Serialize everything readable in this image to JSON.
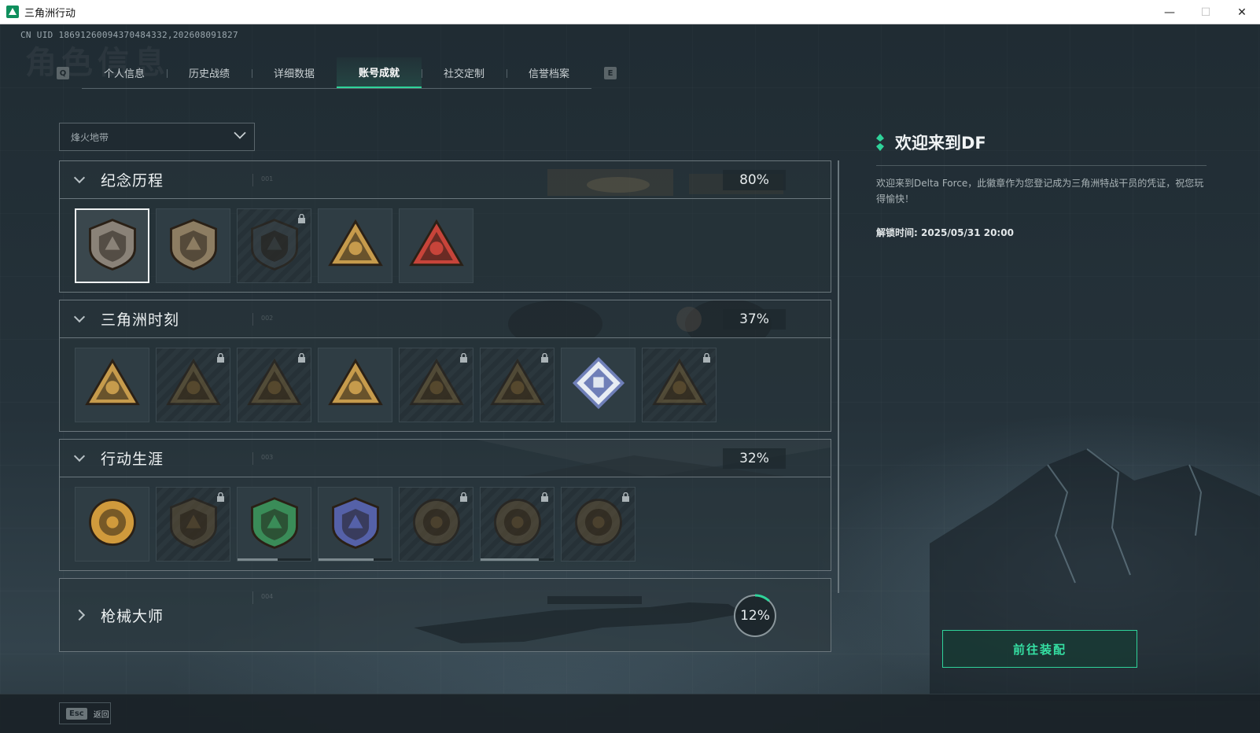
{
  "window": {
    "title": "三角洲行动",
    "minimize": "—",
    "maximize": "☐",
    "close": "✕"
  },
  "uid": "CN UID 18691260094370484332,202608091827",
  "ghost_heading": "角色信息",
  "tabs": {
    "left_key": "Q",
    "right_key": "E",
    "items": [
      {
        "label": "个人信息"
      },
      {
        "label": "历史战绩"
      },
      {
        "label": "详细数据"
      },
      {
        "label": "账号成就"
      },
      {
        "label": "社交定制"
      },
      {
        "label": "信誉档案"
      }
    ],
    "active_index": 3
  },
  "filter": {
    "selected": "烽火地带"
  },
  "sections": [
    {
      "title": "纪念历程",
      "code": "001",
      "percent": "80%",
      "badges": [
        {
          "name": "memorial-badge-1",
          "locked": false,
          "selected": true,
          "icon": "delta-shield-icon",
          "color": "#8a8278"
        },
        {
          "name": "memorial-badge-2",
          "locked": false,
          "selected": false,
          "icon": "helicopter-shield-icon",
          "color": "#8d7d62"
        },
        {
          "name": "memorial-badge-3",
          "locked": true,
          "selected": false,
          "icon": "dark-emblem-icon",
          "color": "#3b4448"
        },
        {
          "name": "memorial-badge-4",
          "locked": false,
          "selected": false,
          "icon": "triangle-boat-icon",
          "color": "#c69b4c"
        },
        {
          "name": "memorial-badge-5",
          "locked": false,
          "selected": false,
          "icon": "triangle-number-one-icon",
          "color": "#c7443a"
        }
      ]
    },
    {
      "title": "三角洲时刻",
      "code": "002",
      "percent": "37%",
      "badges": [
        {
          "name": "moment-badge-1",
          "locked": false,
          "icon": "triangle-figure-icon",
          "color": "#c69b4c"
        },
        {
          "name": "moment-badge-2",
          "locked": true,
          "icon": "triangle-runner-icon",
          "color": "#6d5a36"
        },
        {
          "name": "moment-badge-3",
          "locked": true,
          "icon": "triangle-crab-icon",
          "color": "#6d5a36"
        },
        {
          "name": "moment-badge-4",
          "locked": false,
          "icon": "triangle-soldiers-icon",
          "color": "#c69b4c"
        },
        {
          "name": "moment-badge-5",
          "locked": true,
          "icon": "triangle-squad-icon",
          "color": "#6d5a36"
        },
        {
          "name": "moment-badge-6",
          "locked": true,
          "icon": "triangle-fish-icon",
          "color": "#6d5a36"
        },
        {
          "name": "moment-badge-7",
          "locked": false,
          "icon": "diamond-gem-icon",
          "color": "#6f7fb8"
        },
        {
          "name": "moment-badge-8",
          "locked": true,
          "icon": "triangle-dragon-icon",
          "color": "#6d5a36"
        }
      ]
    },
    {
      "title": "行动生涯",
      "code": "003",
      "percent": "32%",
      "badges": [
        {
          "name": "career-badge-1",
          "locked": false,
          "icon": "star-medal-icon",
          "color": "#d09a3c"
        },
        {
          "name": "career-badge-2",
          "locked": true,
          "icon": "dark-shield-icon",
          "color": "#5c4e35"
        },
        {
          "name": "career-badge-3",
          "locked": false,
          "icon": "green-shield-icon",
          "color": "#3a8c58",
          "progress": 0.55
        },
        {
          "name": "career-badge-4",
          "locked": false,
          "icon": "blue-shield-icon",
          "color": "#5561a8",
          "progress": 0.75
        },
        {
          "name": "career-badge-5",
          "locked": true,
          "icon": "round-dark-emblem-icon",
          "color": "#5c4e35"
        },
        {
          "name": "career-badge-6",
          "locked": true,
          "icon": "round-skull-emblem-icon",
          "color": "#5c4e35",
          "progress": 0.8
        },
        {
          "name": "career-badge-7",
          "locked": true,
          "icon": "round-eye-emblem-icon",
          "color": "#5c4e35"
        }
      ]
    }
  ],
  "collapsed_section": {
    "title": "枪械大师",
    "code": "004",
    "percent": "12%",
    "progress": 0.12
  },
  "info": {
    "title": "欢迎来到DF",
    "description": "欢迎来到Delta Force，此徽章作为您登记成为三角洲特战干员的凭证，祝您玩得愉快！",
    "unlock": "解锁时间: 2025/05/31 20:00"
  },
  "equip_button": "前往装配",
  "footer": {
    "key": "Esc",
    "label": "返回"
  },
  "colors": {
    "accent": "#2fd39a",
    "panel_border": "#6b777d"
  }
}
